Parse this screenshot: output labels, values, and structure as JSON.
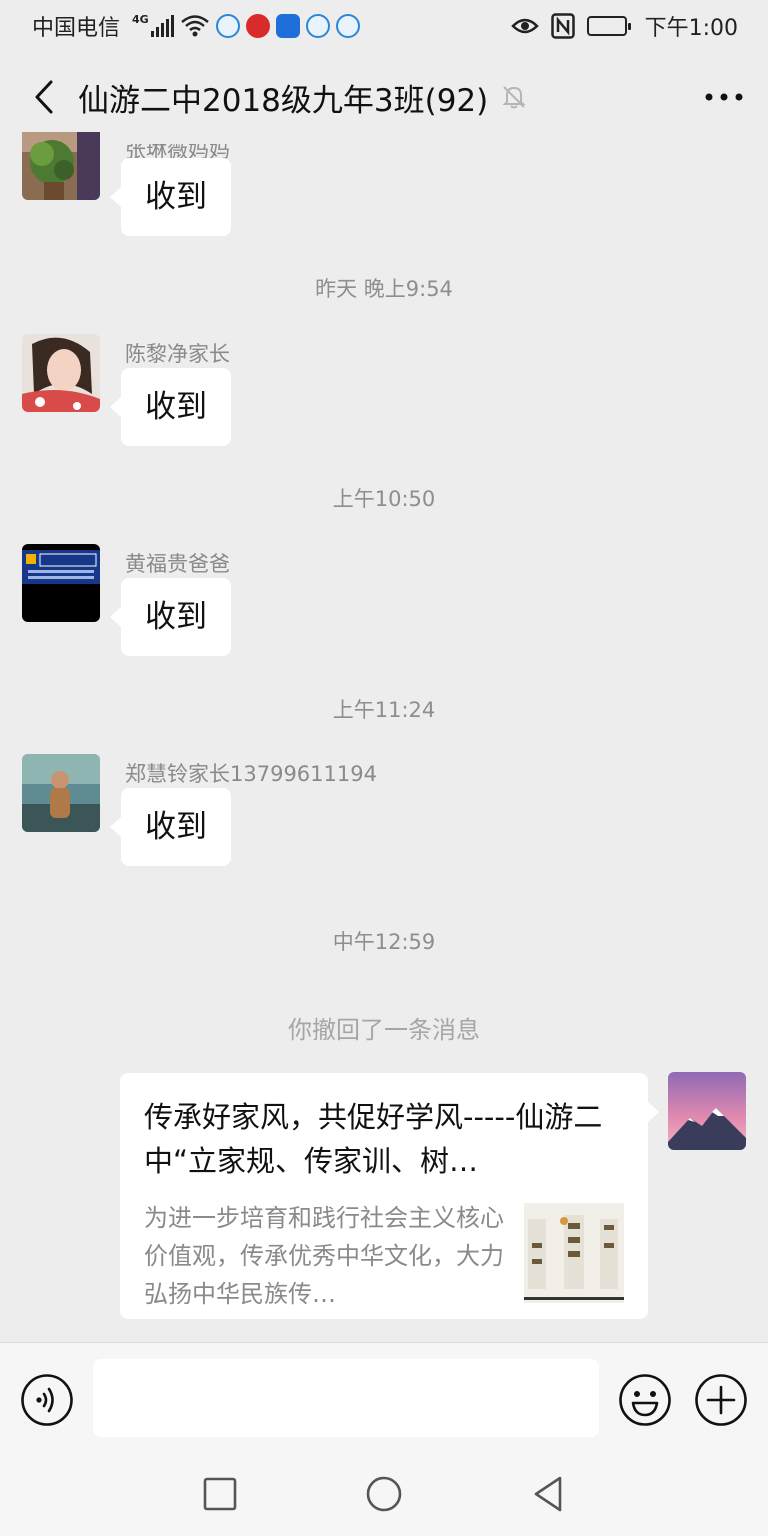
{
  "status_bar": {
    "carrier": "中国电信",
    "network": "4G",
    "time": "下午1:00",
    "icons": [
      "signal-icon",
      "wifi-icon",
      "app-icon",
      "weibo-icon",
      "shield-icon",
      "app-icon",
      "app-icon",
      "eye-icon",
      "nfc-icon",
      "battery-icon"
    ]
  },
  "header": {
    "title": "仙游二中2018级九年3班(92)",
    "icons": [
      "back-icon",
      "mute-bell-icon",
      "more-icon"
    ]
  },
  "messages": [
    {
      "sender": "张琳薇妈妈",
      "text": "收到",
      "avatar": "plant-photo"
    },
    {
      "timestamp": "昨天 晚上9:54"
    },
    {
      "sender": "陈黎净家长",
      "text": "收到",
      "avatar": "woman-photo"
    },
    {
      "timestamp": "上午10:50"
    },
    {
      "sender": "黄福贵爸爸",
      "text": "收到",
      "avatar": "shop-sign-photo"
    },
    {
      "timestamp": "上午11:24"
    },
    {
      "sender": "郑慧铃家长13799611194",
      "text": "收到",
      "avatar": "child-photo"
    },
    {
      "timestamp": "中午12:59"
    },
    {
      "system": "你撤回了一条消息"
    }
  ],
  "link_card": {
    "title": "传承好家风，共促好学风-----仙游二中“立家规、传家训、树…",
    "description": "为进一步培育和践行社会主义核心价值观，传承优秀中华文化，大力弘扬中华民族传…",
    "thumbnail": "calligraphy-thumbnail",
    "self_avatar": "mountain-photo"
  },
  "input_bar": {
    "placeholder": "",
    "icons": [
      "voice-icon",
      "emoji-icon",
      "plus-icon"
    ]
  },
  "system_nav": {
    "icons": [
      "recent-apps-icon",
      "home-icon",
      "back-triangle-icon"
    ]
  },
  "colors": {
    "background": "#ededed",
    "bubble": "#ffffff",
    "muted_text": "#8a8a8a"
  }
}
